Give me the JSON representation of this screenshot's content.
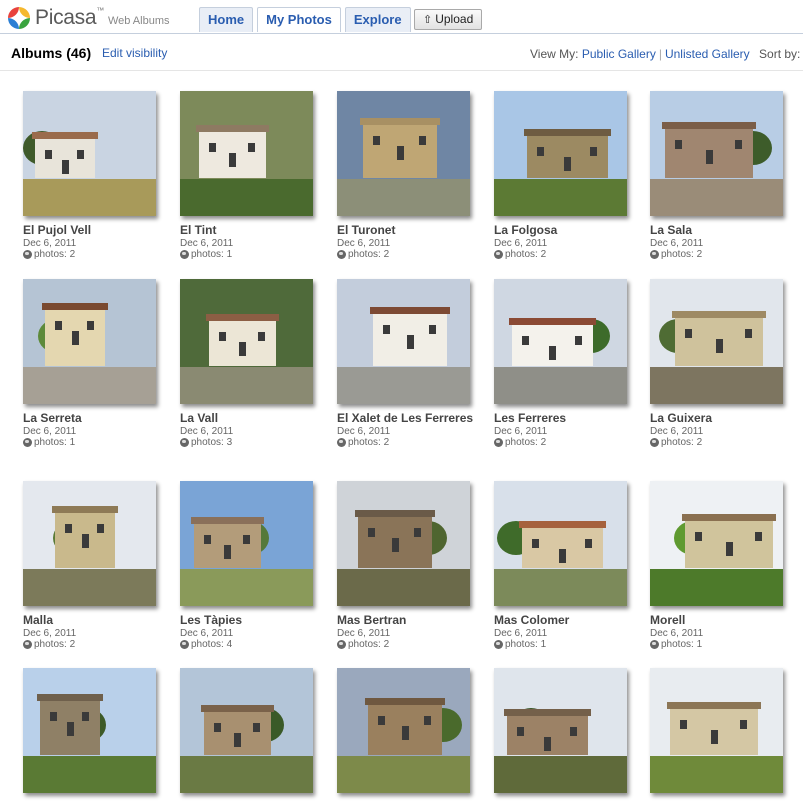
{
  "app": {
    "logo_text": "Picasa",
    "logo_tm": "™",
    "logo_sub": "Web Albums"
  },
  "tabs": [
    {
      "label": "Home",
      "active": false
    },
    {
      "label": "My Photos",
      "active": true
    },
    {
      "label": "Explore",
      "active": false
    }
  ],
  "upload_label": "Upload",
  "subheader": {
    "title": "Albums (46)",
    "edit_visibility": "Edit visibility",
    "view_my_label": "View My:",
    "public_gallery": "Public Gallery",
    "separator": "|",
    "unlisted_gallery": "Unlisted Gallery",
    "sort_by": "Sort by:"
  },
  "colors": {
    "link": "#2a5db0",
    "tab_bg": "#e9eef6",
    "tab_border": "#c5cfdd"
  },
  "albums": [
    {
      "title": "El Pujol Vell",
      "date": "Dec 6, 2011",
      "count": "photos: 2",
      "sky": "#c9d4e2",
      "ground": "#a89a5a",
      "bldg": "#e8e4da",
      "roof": "#9a6b4c",
      "tree": "#3f5a2a"
    },
    {
      "title": "El Tint",
      "date": "Dec 6, 2011",
      "count": "photos: 1",
      "sky": "#7d8a5a",
      "ground": "#4a6a2e",
      "bldg": "#eee9df",
      "roof": "#8e7a62",
      "tree": "#35551f"
    },
    {
      "title": "El Turonet",
      "date": "Dec 6, 2011",
      "count": "photos: 2",
      "sky": "#6f86a4",
      "ground": "#8c8f78",
      "bldg": "#bfa674",
      "roof": "#a89063",
      "tree": "#4d5d36"
    },
    {
      "title": "La Folgosa",
      "date": "Dec 6, 2011",
      "count": "photos: 2",
      "sky": "#a9c6e6",
      "ground": "#5c7a34",
      "bldg": "#9c8a62",
      "roof": "#6e5c42",
      "tree": "#4a6b2c"
    },
    {
      "title": "La Sala",
      "date": "Dec 6, 2011",
      "count": "photos: 2",
      "sky": "#b8cde5",
      "ground": "#9a8c78",
      "bldg": "#a08670",
      "roof": "#7b5e48",
      "tree": "#3d5c2a"
    },
    {
      "title": "La Serreta",
      "date": "Dec 6, 2011",
      "count": "photos: 1",
      "sky": "#b5c4d4",
      "ground": "#a6a095",
      "bldg": "#e4d7b0",
      "roof": "#7a4a30",
      "tree": "#5d8a3a"
    },
    {
      "title": "La Vall",
      "date": "Dec 6, 2011",
      "count": "photos: 3",
      "sky": "#4f6a3a",
      "ground": "#8a8a72",
      "bldg": "#ece6d6",
      "roof": "#8c5e44",
      "tree": "#6fa53a"
    },
    {
      "title": "El Xalet de Les Ferreres",
      "date": "Dec 6, 2011",
      "count": "photos: 2",
      "sky": "#c3cddc",
      "ground": "#9a9a94",
      "bldg": "#f1eee6",
      "roof": "#7d4a34",
      "tree": "#4d6b30"
    },
    {
      "title": "Les Ferreres",
      "date": "Dec 6, 2011",
      "count": "photos: 2",
      "sky": "#cfd7e2",
      "ground": "#8f8f88",
      "bldg": "#f4f2ec",
      "roof": "#8b4a34",
      "tree": "#3d6b2a"
    },
    {
      "title": "La Guixera",
      "date": "Dec 6, 2011",
      "count": "photos: 2",
      "sky": "#e1e6ec",
      "ground": "#7d7560",
      "bldg": "#cfc29c",
      "roof": "#9e8a64",
      "tree": "#4f6c34"
    },
    {
      "title": "Malla",
      "date": "Dec 6, 2011",
      "count": "photos: 2",
      "sky": "#e4e8ee",
      "ground": "#7c7a5a",
      "bldg": "#c9b98c",
      "roof": "#8e7a56",
      "tree": "#5a7a36"
    },
    {
      "title": "Les Tàpies",
      "date": "Dec 6, 2011",
      "count": "photos: 4",
      "sky": "#7aa4d6",
      "ground": "#8a9a5a",
      "bldg": "#b39c7a",
      "roof": "#8a705a",
      "tree": "#55793a"
    },
    {
      "title": "Mas Bertran",
      "date": "Dec 6, 2011",
      "count": "photos: 2",
      "sky": "#cfd3d8",
      "ground": "#6b6a4a",
      "bldg": "#8a7458",
      "roof": "#6a5a48",
      "tree": "#4f6530"
    },
    {
      "title": "Mas Colomer",
      "date": "Dec 6, 2011",
      "count": "photos: 1",
      "sky": "#d8e0ea",
      "ground": "#7c8a5a",
      "bldg": "#d9c8a4",
      "roof": "#a6623e",
      "tree": "#3f6b2a"
    },
    {
      "title": "Morell",
      "date": "Dec 6, 2011",
      "count": "photos: 1",
      "sky": "#eef1f4",
      "ground": "#4d7a2a",
      "bldg": "#d0c49c",
      "roof": "#8a7050",
      "tree": "#5f9a30"
    },
    {
      "title": "",
      "date": "",
      "count": "",
      "sky": "#b9d0ea",
      "ground": "#5a7a34",
      "bldg": "#8f8066",
      "roof": "#6f604c",
      "tree": "#3d5a28"
    },
    {
      "title": "",
      "date": "",
      "count": "",
      "sky": "#b3c5d8",
      "ground": "#6a7a44",
      "bldg": "#a89070",
      "roof": "#7a624a",
      "tree": "#3a5a28"
    },
    {
      "title": "",
      "date": "",
      "count": "",
      "sky": "#9aa8bd",
      "ground": "#7d8a4a",
      "bldg": "#9a805e",
      "roof": "#6f5840",
      "tree": "#4a6a2c"
    },
    {
      "title": "",
      "date": "",
      "count": "",
      "sky": "#dfe5ec",
      "ground": "#5f6a3a",
      "bldg": "#9c8266",
      "roof": "#74604a",
      "tree": "#3a5628"
    },
    {
      "title": "",
      "date": "",
      "count": "",
      "sky": "#e8ecf0",
      "ground": "#6f8a3a",
      "bldg": "#d4c7a4",
      "roof": "#8c7656",
      "tree": "#4d7030"
    }
  ]
}
